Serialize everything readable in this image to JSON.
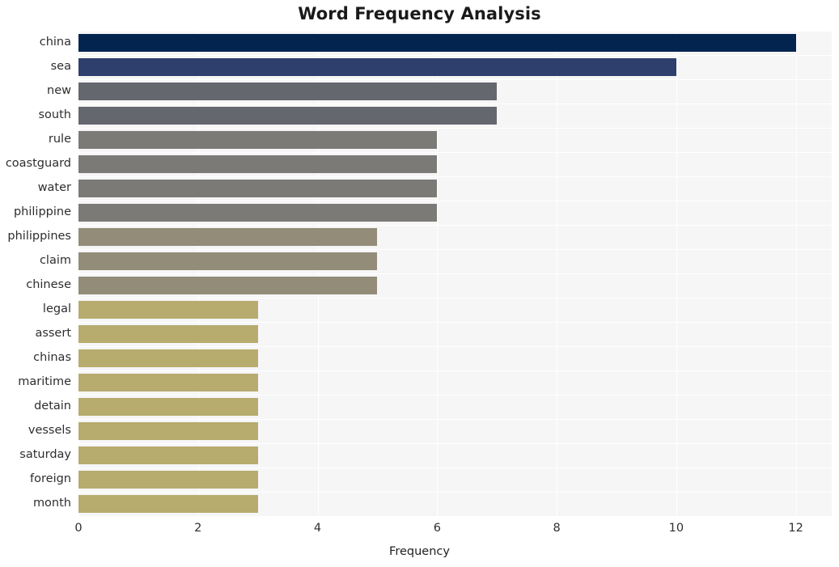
{
  "chart_data": {
    "type": "bar",
    "orientation": "horizontal",
    "title": "Word Frequency Analysis",
    "xlabel": "Frequency",
    "ylabel": "",
    "xlim": [
      0,
      12.6
    ],
    "xticks": [
      0,
      2,
      4,
      6,
      8,
      10,
      12
    ],
    "xtick_labels": [
      "0",
      "2",
      "4",
      "6",
      "8",
      "10",
      "12"
    ],
    "grid": true,
    "legend": "none",
    "categories": [
      "china",
      "sea",
      "new",
      "south",
      "rule",
      "coastguard",
      "water",
      "philippine",
      "philippines",
      "claim",
      "chinese",
      "legal",
      "assert",
      "chinas",
      "maritime",
      "detain",
      "vessels",
      "saturday",
      "foreign",
      "month"
    ],
    "values": [
      12,
      10,
      7,
      7,
      6,
      6,
      6,
      6,
      5,
      5,
      5,
      3,
      3,
      3,
      3,
      3,
      3,
      3,
      3,
      3
    ],
    "bar_colors": [
      "#042450",
      "#2f3f6d",
      "#65676f",
      "#65676f",
      "#7b7a77",
      "#7b7a77",
      "#7b7a77",
      "#7b7a77",
      "#928c79",
      "#928c79",
      "#928c79",
      "#b7ab6e",
      "#b7ab6e",
      "#b7ab6e",
      "#b7ab6e",
      "#b7ab6e",
      "#b7ab6e",
      "#b7ab6e",
      "#b7ab6e",
      "#b7ab6e"
    ],
    "plot_background": "#f6f6f7",
    "grid_color": "#ffffff",
    "figure_background": "#ffffff",
    "text_color": "#2e2e2e"
  }
}
